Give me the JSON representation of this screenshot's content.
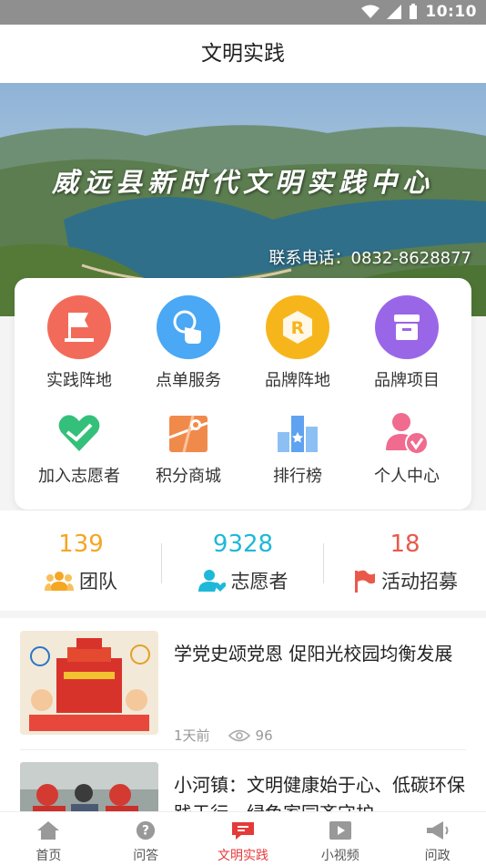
{
  "status_bar": {
    "time": "10:10"
  },
  "header": {
    "title": "文明实践"
  },
  "banner": {
    "title": "威远县新时代文明实践中心",
    "phone": "联系电话：0832-8628877"
  },
  "grid": [
    {
      "label": "实践阵地",
      "icon": "flag-icon",
      "color": "#f26b5a"
    },
    {
      "label": "点单服务",
      "icon": "touch-icon",
      "color": "#4aa8f5"
    },
    {
      "label": "品牌阵地",
      "icon": "brand-r-icon",
      "color": "#f7b51c"
    },
    {
      "label": "品牌项目",
      "icon": "box-icon",
      "color": "#9a66e8"
    },
    {
      "label": "加入志愿者",
      "icon": "heart-hands-icon",
      "color": "#34c07a"
    },
    {
      "label": "积分商城",
      "icon": "map-icon",
      "color": "#f08a4b"
    },
    {
      "label": "排行榜",
      "icon": "ranking-icon",
      "color": "#5ea2f0"
    },
    {
      "label": "个人中心",
      "icon": "user-check-icon",
      "color": "#f06b8f"
    }
  ],
  "stats": [
    {
      "value": "139",
      "label": "团队",
      "color": "#f5a623",
      "icon": "team-icon"
    },
    {
      "value": "9328",
      "label": "志愿者",
      "color": "#1fb8d8",
      "icon": "volunteer-icon"
    },
    {
      "value": "18",
      "label": "活动招募",
      "color": "#e9594a",
      "icon": "flag-icon"
    }
  ],
  "news": [
    {
      "title": "学党史颂党恩 促阳光校园均衡发展",
      "time": "1天前",
      "views": "96"
    },
    {
      "title": "小河镇：文明健康始于心、低碳环保践于行、绿色家园齐守护",
      "time": "",
      "views": ""
    }
  ],
  "tabs": [
    {
      "label": "首页",
      "icon": "home-icon",
      "active": false
    },
    {
      "label": "问答",
      "icon": "question-icon",
      "active": false
    },
    {
      "label": "文明实践",
      "icon": "chat-flag-icon",
      "active": true
    },
    {
      "label": "小视频",
      "icon": "video-icon",
      "active": false
    },
    {
      "label": "问政",
      "icon": "megaphone-icon",
      "active": false
    }
  ],
  "colors": {
    "accent": "#e53a3a"
  }
}
